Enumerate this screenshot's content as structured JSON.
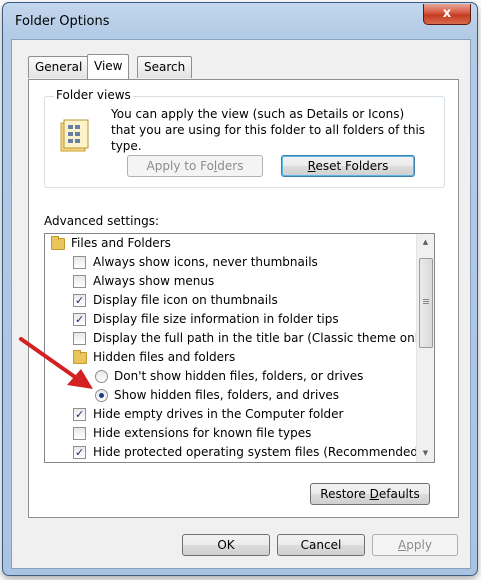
{
  "window": {
    "title": "Folder Options",
    "close_glyph": "x"
  },
  "tabs": [
    {
      "label": "General",
      "active": false
    },
    {
      "label": "View",
      "active": true
    },
    {
      "label": "Search",
      "active": false
    }
  ],
  "folder_views": {
    "label": "Folder views",
    "description": "You can apply the view (such as Details or Icons) that you are using for this folder to all folders of this type.",
    "apply_button": {
      "pre": "Apply to Fo",
      "u": "l",
      "post": "ders"
    },
    "reset_button": {
      "pre": "",
      "u": "R",
      "post": "eset Folders"
    }
  },
  "advanced": {
    "label": "Advanced settings:",
    "items": [
      {
        "kind": "folder",
        "label": "Files and Folders"
      },
      {
        "kind": "checkbox",
        "checked": false,
        "label": "Always show icons, never thumbnails"
      },
      {
        "kind": "checkbox",
        "checked": false,
        "label": "Always show menus"
      },
      {
        "kind": "checkbox",
        "checked": true,
        "label": "Display file icon on thumbnails"
      },
      {
        "kind": "checkbox",
        "checked": true,
        "label": "Display file size information in folder tips"
      },
      {
        "kind": "checkbox",
        "checked": false,
        "label": "Display the full path in the title bar (Classic theme only)"
      },
      {
        "kind": "folder",
        "label": "Hidden files and folders"
      },
      {
        "kind": "radio",
        "checked": false,
        "label": "Don't show hidden files, folders, or drives"
      },
      {
        "kind": "radio",
        "checked": true,
        "label": "Show hidden files, folders, and drives"
      },
      {
        "kind": "checkbox",
        "checked": true,
        "label": "Hide empty drives in the Computer folder"
      },
      {
        "kind": "checkbox",
        "checked": false,
        "label": "Hide extensions for known file types"
      },
      {
        "kind": "checkbox",
        "checked": true,
        "label": "Hide protected operating system files (Recommended)"
      }
    ]
  },
  "restore_button": {
    "pre": "Restore ",
    "u": "D",
    "post": "efaults"
  },
  "footer": {
    "ok": "OK",
    "cancel": "Cancel",
    "apply": {
      "pre": "",
      "u": "A",
      "post": "pply"
    }
  },
  "colors": {
    "annotation_arrow": "#d32020"
  }
}
